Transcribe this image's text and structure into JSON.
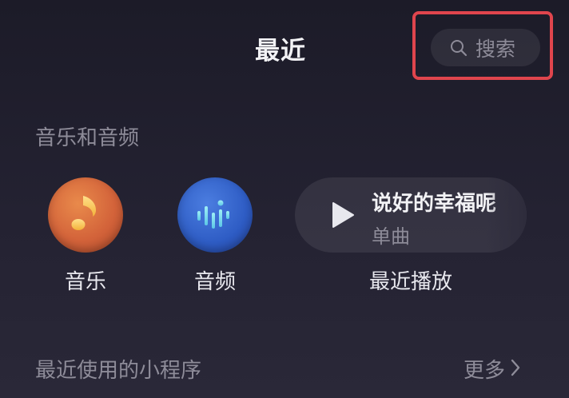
{
  "header": {
    "title": "最近",
    "search_label": "搜索"
  },
  "sections": {
    "music_audio_label": "音乐和音频",
    "mini_programs_label": "最近使用的小程序",
    "more_label": "更多"
  },
  "categories": [
    {
      "label": "音乐",
      "icon": "music-note-icon"
    },
    {
      "label": "音频",
      "icon": "audio-wave-icon"
    }
  ],
  "recent": {
    "track_title": "说好的幸福呢",
    "track_type": "单曲",
    "label": "最近播放"
  },
  "colors": {
    "highlight": "#e0454d",
    "music_circle": "#d3633a",
    "audio_circle": "#2e5cc4"
  }
}
